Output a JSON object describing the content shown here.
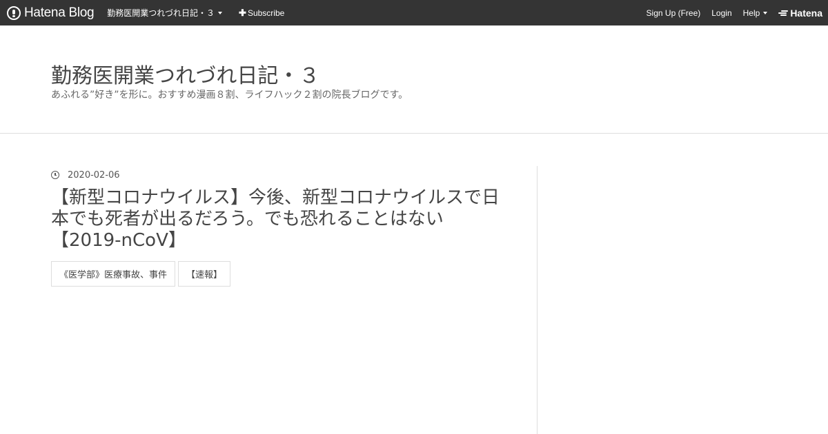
{
  "topbar": {
    "brand": "Hatena Blog",
    "blog_menu_label": "勤務医開業つれづれ日記・３",
    "subscribe_label": "Subscribe",
    "signup_label": "Sign Up (Free)",
    "login_label": "Login",
    "help_label": "Help",
    "hatena_label": "Hatena"
  },
  "header": {
    "title": "勤務医開業つれづれ日記・３",
    "description": "あふれる”好き”を形に。おすすめ漫画８割、ライフハック２割の院長ブログです。"
  },
  "entry": {
    "date": "2020-02-06",
    "title": "【新型コロナウイルス】今後、新型コロナウイルスで日本でも死者が出るだろう。でも恐れることはない【2019-nCoV】",
    "categories": [
      "《医学部》医療事故、事件",
      "【速報】"
    ]
  },
  "colors": {
    "topbar_bg": "#343434",
    "text": "#454545",
    "border": "#dddddd"
  }
}
